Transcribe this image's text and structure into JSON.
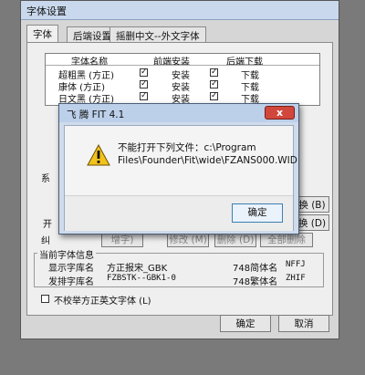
{
  "main_window": {
    "title": "字体设置",
    "tabs": [
      "字体",
      "后端设置",
      "摇删中文--外文字体"
    ],
    "font_table": {
      "headers": [
        "字体名称",
        "前端安装",
        "后端下载"
      ],
      "rows": [
        {
          "name": "超粗黑 (方正)",
          "front": "安装",
          "back": "下载"
        },
        {
          "name": "康体 (方正)",
          "front": "安装",
          "back": "下载"
        },
        {
          "name": "日文黑 (方正)",
          "front": "安装",
          "back": "下载"
        }
      ]
    },
    "side_labels": [
      "系",
      "开",
      "纠"
    ],
    "right_buttons": [
      "换 (B)",
      "换 (D)"
    ],
    "lower_row": [
      "增字)",
      "修改 (M)",
      "删除 (D)",
      "全部删除"
    ],
    "current_font": {
      "group_label": "当前字体信息",
      "display_label": "显示字库名",
      "display_value": "方正报宋_GBK",
      "typeset_label": "发排字库名",
      "typeset_value": "FZBSTK--GBK1-0",
      "simp_label": "748简体名",
      "simp_value": "NFFJ",
      "trad_label": "748繁体名",
      "trad_value": "ZHIF"
    },
    "checkbox_label": "不校举方正英文字体 (L)",
    "ok_label": "确定",
    "cancel_label": "取消"
  },
  "dialog": {
    "title": "飞 腾 FIT 4.1",
    "message_line1": "不能打开下列文件：c:\\Program",
    "message_line2": "Files\\Founder\\Fit\\wide\\FZANS000.WID",
    "ok_label": "确定",
    "close_glyph": "x"
  }
}
